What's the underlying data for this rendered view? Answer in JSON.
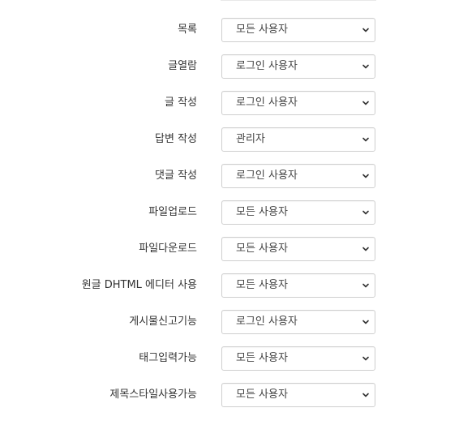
{
  "permissions": [
    {
      "label": "목록",
      "value": "모든 사용자"
    },
    {
      "label": "글열람",
      "value": "로그인 사용자"
    },
    {
      "label": "글 작성",
      "value": "로그인 사용자"
    },
    {
      "label": "답변 작성",
      "value": "관리자"
    },
    {
      "label": "댓글 작성",
      "value": "로그인 사용자"
    },
    {
      "label": "파일업로드",
      "value": "모든 사용자"
    },
    {
      "label": "파일다운로드",
      "value": "모든 사용자"
    },
    {
      "label": "원글 DHTML 에디터 사용",
      "value": "모든 사용자"
    },
    {
      "label": "게시물신고기능",
      "value": "로그인 사용자"
    },
    {
      "label": "태그입력가능",
      "value": "모든 사용자"
    },
    {
      "label": "제목스타일사용가능",
      "value": "모든 사용자"
    }
  ],
  "icons": {
    "select_arrow": "chevron-down-icon"
  }
}
